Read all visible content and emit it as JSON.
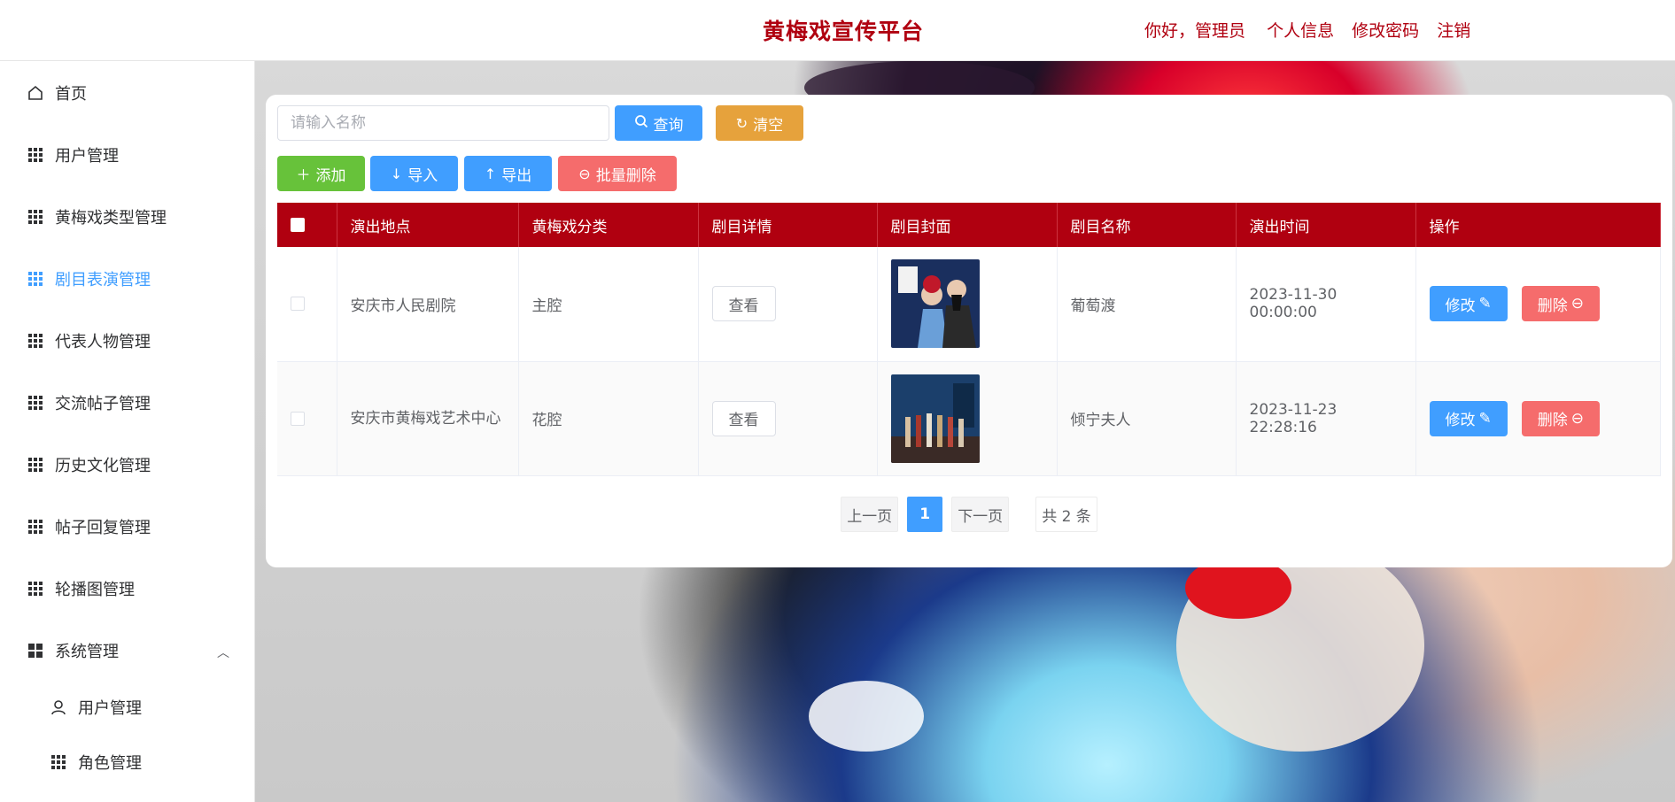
{
  "header": {
    "title": "黄梅戏宣传平台",
    "greeting": "你好，管理员",
    "links": [
      "个人信息",
      "修改密码",
      "注销"
    ]
  },
  "sidebar": {
    "items": [
      {
        "label": "首页",
        "icon": "home-icon"
      },
      {
        "label": "用户管理",
        "icon": "grid-icon"
      },
      {
        "label": "黄梅戏类型管理",
        "icon": "grid-icon"
      },
      {
        "label": "剧目表演管理",
        "icon": "grid-icon",
        "active": true
      },
      {
        "label": "代表人物管理",
        "icon": "grid-icon"
      },
      {
        "label": "交流帖子管理",
        "icon": "grid-icon"
      },
      {
        "label": "历史文化管理",
        "icon": "grid-icon"
      },
      {
        "label": "帖子回复管理",
        "icon": "grid-icon"
      },
      {
        "label": "轮播图管理",
        "icon": "grid-icon"
      },
      {
        "label": "系统管理",
        "icon": "menu-icon",
        "expanded": true
      }
    ],
    "subitems": [
      {
        "label": "用户管理",
        "icon": "user-icon"
      },
      {
        "label": "角色管理",
        "icon": "grid-icon"
      }
    ]
  },
  "search": {
    "placeholder": "请输入名称",
    "query_label": "查询",
    "clear_label": "清空"
  },
  "toolbar": {
    "add_label": "添加",
    "import_label": "导入",
    "export_label": "导出",
    "batch_delete_label": "批量删除"
  },
  "table": {
    "columns": [
      "演出地点",
      "黄梅戏分类",
      "剧目详情",
      "剧目封面",
      "剧目名称",
      "演出时间",
      "操作"
    ],
    "rows": [
      {
        "location": "安庆市人民剧院",
        "category": "主腔",
        "detail_label": "查看",
        "name": "葡萄渡",
        "time": "2023-11-30 00:00:00",
        "edit_label": "修改",
        "delete_label": "删除"
      },
      {
        "location": "安庆市黄梅戏艺术中心",
        "category": "花腔",
        "detail_label": "查看",
        "name": "倾宁夫人",
        "time": "2023-11-23 22:28:16",
        "edit_label": "修改",
        "delete_label": "删除"
      }
    ]
  },
  "pagination": {
    "prev_label": "上一页",
    "current_page": "1",
    "next_label": "下一页",
    "total_label": "共 2 条"
  },
  "colors": {
    "brand": "#b00010",
    "primary": "#409eff",
    "success": "#67c23a",
    "warning": "#e6a23c",
    "danger": "#f56c6c"
  }
}
